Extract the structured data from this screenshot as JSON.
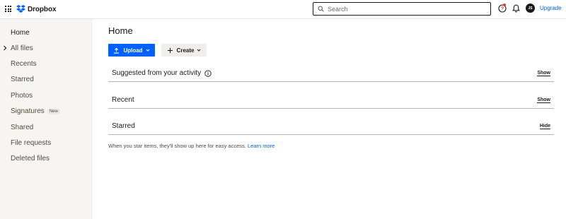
{
  "header": {
    "brand": "Dropbox",
    "search_placeholder": "Search",
    "avatar_initials": "JS",
    "upgrade_label": "Upgrade"
  },
  "sidebar": {
    "items": [
      {
        "label": "Home",
        "active": true
      },
      {
        "label": "All files",
        "expandable": true
      },
      {
        "label": "Recents"
      },
      {
        "label": "Starred"
      },
      {
        "label": "Photos"
      },
      {
        "label": "Signatures",
        "badge": "New"
      },
      {
        "label": "Shared"
      },
      {
        "label": "File requests"
      },
      {
        "label": "Deleted files"
      }
    ]
  },
  "main": {
    "title": "Home",
    "upload_label": "Upload",
    "create_label": "Create",
    "sections": [
      {
        "title": "Suggested from your activity",
        "toggle": "Show",
        "has_info": true
      },
      {
        "title": "Recent",
        "toggle": "Show"
      },
      {
        "title": "Starred",
        "toggle": "Hide"
      }
    ],
    "starred_empty_text": "When you star items, they'll show up here for easy access.",
    "learn_more": "Learn more"
  },
  "colors": {
    "accent": "#0061fe",
    "sidebar_bg": "#f7f5f2",
    "text": "#1e1919"
  },
  "icons": [
    "app-grid-icon",
    "dropbox-logo-icon",
    "search-icon",
    "help-icon",
    "bell-icon",
    "chevron-right-icon",
    "upload-icon",
    "plus-icon",
    "chevron-down-icon",
    "info-icon"
  ]
}
